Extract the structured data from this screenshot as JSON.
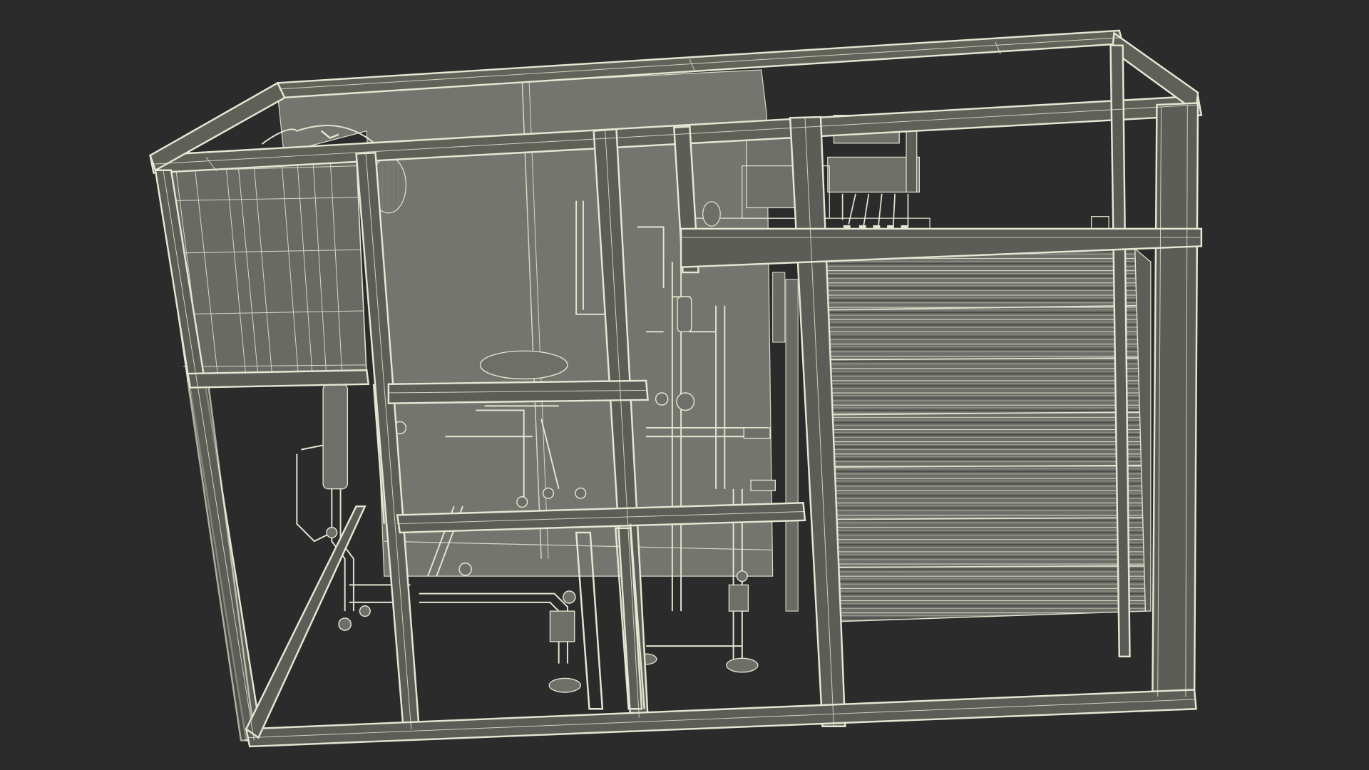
{
  "scene": {
    "subject": "wireframe-render-industrial-skid-unit",
    "background_color": "#2b2b2b",
    "wire_color": "#e4e4d2",
    "panel_color": "#75766e",
    "panel_dark_color": "#5f605a"
  }
}
